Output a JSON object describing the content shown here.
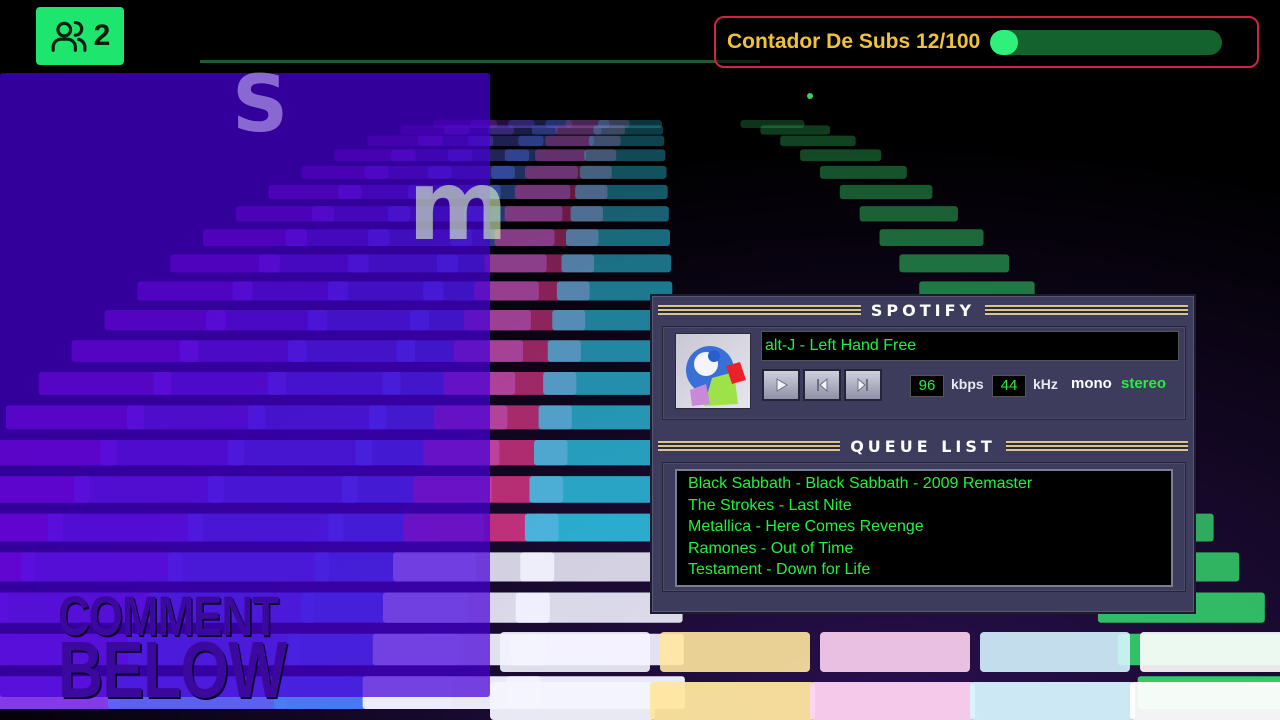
{
  "viewer_badge": {
    "count": "2",
    "icon": "users-icon",
    "color": "#1ee56d"
  },
  "sub_counter": {
    "label": "Contador De Subs 12/100",
    "current": 12,
    "goal": 100,
    "progress": 0.12
  },
  "logo": {
    "s_letter": "S",
    "m_letter": "m"
  },
  "overlay_text": {
    "line1": "COMMENT",
    "line2": "BELOW"
  },
  "player": {
    "title": "SPOTIFY",
    "now_playing": "alt-J - Left Hand Free",
    "album_art": "album-art",
    "controls": [
      "play-icon",
      "previous-icon",
      "next-icon"
    ],
    "bitrate": "96",
    "bitrate_unit": "kbps",
    "samplerate": "44",
    "samplerate_unit": "kHz",
    "mono_label": "mono",
    "stereo_label": "stereo"
  },
  "queue": {
    "title": "QUEUE LIST",
    "items": [
      "Black Sabbath - Black Sabbath - 2009 Remaster",
      "The Strokes - Last Nite",
      "Metallica - Here Comes Revenge",
      "Ramones - Out of Time",
      "Testament - Down for Life"
    ]
  },
  "colors": {
    "accent_green": "#22f03c",
    "counter_border": "#d32344",
    "counter_text": "#f0c23b",
    "panel_purple": "#4600d7"
  }
}
